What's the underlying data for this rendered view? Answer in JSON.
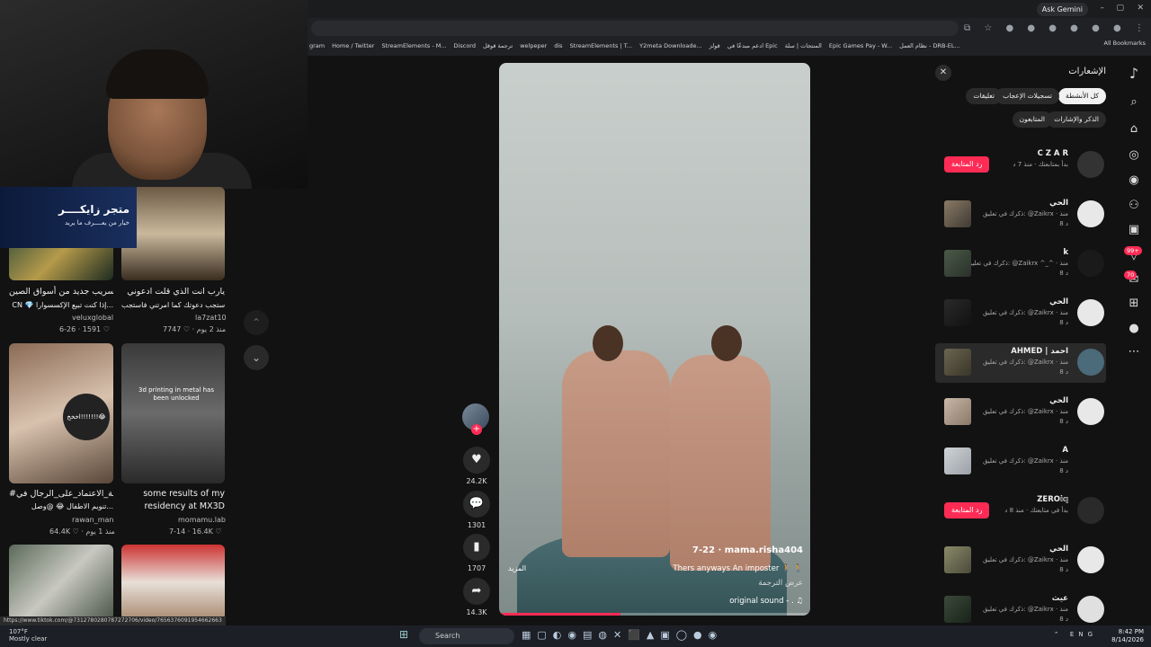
{
  "browser": {
    "ask_gemini": "Ask Gemini",
    "bookmarks": [
      "gram",
      "Home / Twitter",
      "StreamElements - M...",
      "Discord",
      "ترجمة قوقل",
      "welpeper",
      "dis",
      "StreamElements | T...",
      "Y2meta Downloade...",
      "قولز",
      "ادعم مبدعًا في Epic",
      "المنتجات | سلة",
      "Epic Games Pay - W...",
      "نظام العمل - DRB-EL..."
    ],
    "all_bookmarks": "All Bookmarks"
  },
  "stream": {
    "store_name": "متجر زايكــــر",
    "store_tagline": "خيار من يعــــرف ما يريد"
  },
  "grid": [
    {
      "caption1": "تسريب جديد من أسواق الصين!",
      "caption2": "CN 💎 إذا كنت تبيع الإكسسوارا...",
      "user": "veluxglobal",
      "stats": "6-26 · 1591 ♡"
    },
    {
      "caption1": "يارب انت الذي قلت ادعوني",
      "caption2": "استجب دعوتك كما امرتني فاستجب...",
      "user": "la7zat10",
      "stats": "7747 ♡ · منذ 2 يوم"
    },
    {
      "caption1": "#حملة_الاعتماد_على_الرجال في",
      "caption2": "تنويم الاطفال 😂 @وصل...",
      "user": "rawan_man",
      "stats": "64.4K ♡ · منذ 1 يوم",
      "overlay": "اخخخ!!!!!!!😂"
    },
    {
      "caption1": "some results of my",
      "caption2": "residency at MX3D",
      "user": "momamu.lab",
      "stats": "7-14 · 16.4K ♡",
      "overlay": "3d printing in metal has been unlocked"
    }
  ],
  "video": {
    "username": "7-22 · mama.risha404",
    "description": "Thers anyways An imposter 🚶 🚶",
    "translate": "عرض الترجمة",
    "sound": "original sound - . ♫",
    "more": "المزيد",
    "progress": 0.39
  },
  "actions": {
    "likes": "24.2K",
    "comments": "1301",
    "saves": "1707",
    "shares": "14.3K"
  },
  "notifications": {
    "title": "الإشعارات",
    "tabs": [
      "كل الأنشطة",
      "تسجيلات الإعجاب",
      "تعليقات",
      "الذكر والإشارات",
      "المتابعون"
    ],
    "follow_back": "رد المتابعة",
    "items": [
      {
        "name": "C Z A R",
        "sub": "بدأ بمتابعتك · منذ 7 د",
        "time": "",
        "type": "follow"
      },
      {
        "name": "الحي",
        "sub": "ذكرك في تعليق: @Zaikrx · منذ",
        "time": "8 د",
        "type": "mention"
      },
      {
        "name": "k",
        "sub": "ذكرك في تعليق: @Zaikrx ^_^ · منذ",
        "time": "8 د",
        "type": "mention"
      },
      {
        "name": "الحي",
        "sub": "ذكرك في تعليق: @Zaikrx · منذ",
        "time": "8 د",
        "type": "mention"
      },
      {
        "name": "AHMED | احمد",
        "sub": "ذكرك في تعليق: @Zaikrx · منذ",
        "time": "8 د",
        "type": "mention",
        "highlight": true
      },
      {
        "name": "الحي",
        "sub": "ذكرك في تعليق: @Zaikrx · منذ",
        "time": "8 د",
        "type": "mention"
      },
      {
        "name": "A",
        "sub": "ذكرك في تعليق: @Zaikrx · منذ",
        "time": "8 د",
        "type": "mention"
      },
      {
        "name": "ZERO𝕚𝕢",
        "sub": "بدأ في متابعتك · منذ 8 د",
        "time": "",
        "type": "follow"
      },
      {
        "name": "الحي",
        "sub": "ذكرك في تعليق: @Zaikrx · منذ",
        "time": "8 د",
        "type": "mention"
      },
      {
        "name": "عيث",
        "sub": "ذكرك في تعليق: @Zaikrx · منذ",
        "time": "8 د",
        "type": "mention"
      }
    ]
  },
  "rail": {
    "badge_inbox": "99+",
    "badge_msgs": "70"
  },
  "taskbar": {
    "url_hint": "https://www.tiktok.com/@7312780280787272706/video/7656376091954662663",
    "weather_temp": "107°F",
    "weather_desc": "Mostly clear",
    "search": "Search",
    "lang": "ENG",
    "time": "8:42 PM",
    "date": "8/14/2026"
  }
}
